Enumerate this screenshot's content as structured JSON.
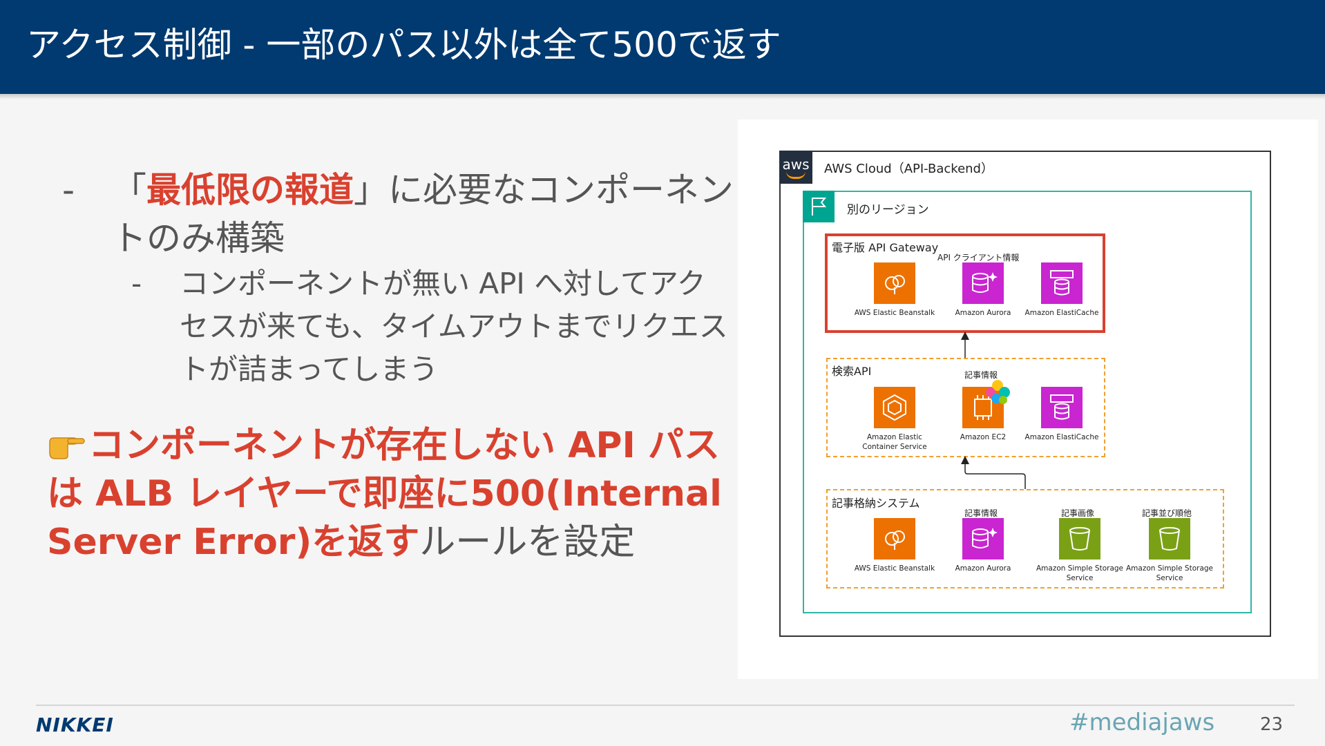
{
  "header": {
    "title": "アクセス制御 - 一部のパス以外は全て500で返す"
  },
  "bullets": {
    "b1_dash": "-",
    "b1_pre": "「",
    "b1_highlight": "最低限の報道",
    "b1_post": "」に必要なコンポーネントのみ構築",
    "b2_dash": "-",
    "b2_text": "コンポーネントが無い API へ対してアクセスが来ても、タイムアウトまでリクエストが詰まってしまう"
  },
  "callout": {
    "bold_text": "コンポーネントが存在しない API パスは ALB レイヤーで即座に500(Internal Server Error)を返す",
    "normal_text": "ルールを設定"
  },
  "diagram": {
    "aws_logo": "aws",
    "cloud_label": "AWS Cloud（API-Backend）",
    "region_label": "別のリージョン",
    "gateway": {
      "title": "電子版 API Gateway",
      "sub_label": "API クライアント情報",
      "services": [
        "AWS Elastic Beanstalk",
        "Amazon Aurora",
        "Amazon ElastiCache"
      ]
    },
    "search": {
      "title": "検索API",
      "sub_label": "記事情報",
      "services": [
        "Amazon Elastic Container Service",
        "Amazon EC2",
        "Amazon ElastiCache"
      ]
    },
    "store": {
      "title": "記事格納システム",
      "sub_labels": [
        "記事情報",
        "記事画像",
        "記事並び順他"
      ],
      "services": [
        "AWS Elastic Beanstalk",
        "Amazon Aurora",
        "Amazon Simple Storage Service",
        "Amazon Simple Storage Service"
      ]
    }
  },
  "footer": {
    "logo": "NIKKEI",
    "hashtag": "#mediajaws",
    "page": "23"
  },
  "colors": {
    "header_bg": "#003a70",
    "accent_red": "#d9412f",
    "region_teal": "#2fb5a5",
    "group_orange": "#f0a030"
  }
}
